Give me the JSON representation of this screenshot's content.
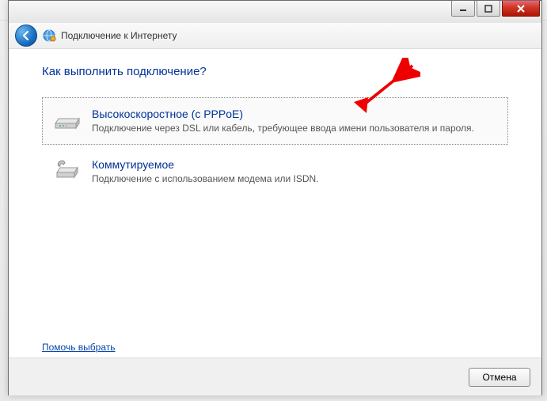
{
  "window": {
    "title": "Подключение к Интернету"
  },
  "heading": "Как выполнить подключение?",
  "options": [
    {
      "title": "Высокоскоростное (с PPPoE)",
      "desc": "Подключение через DSL или кабель, требующее ввода имени пользователя и пароля."
    },
    {
      "title": "Коммутируемое",
      "desc": "Подключение с использованием модема или ISDN."
    }
  ],
  "help_link": "Помочь выбрать",
  "buttons": {
    "cancel": "Отмена"
  }
}
